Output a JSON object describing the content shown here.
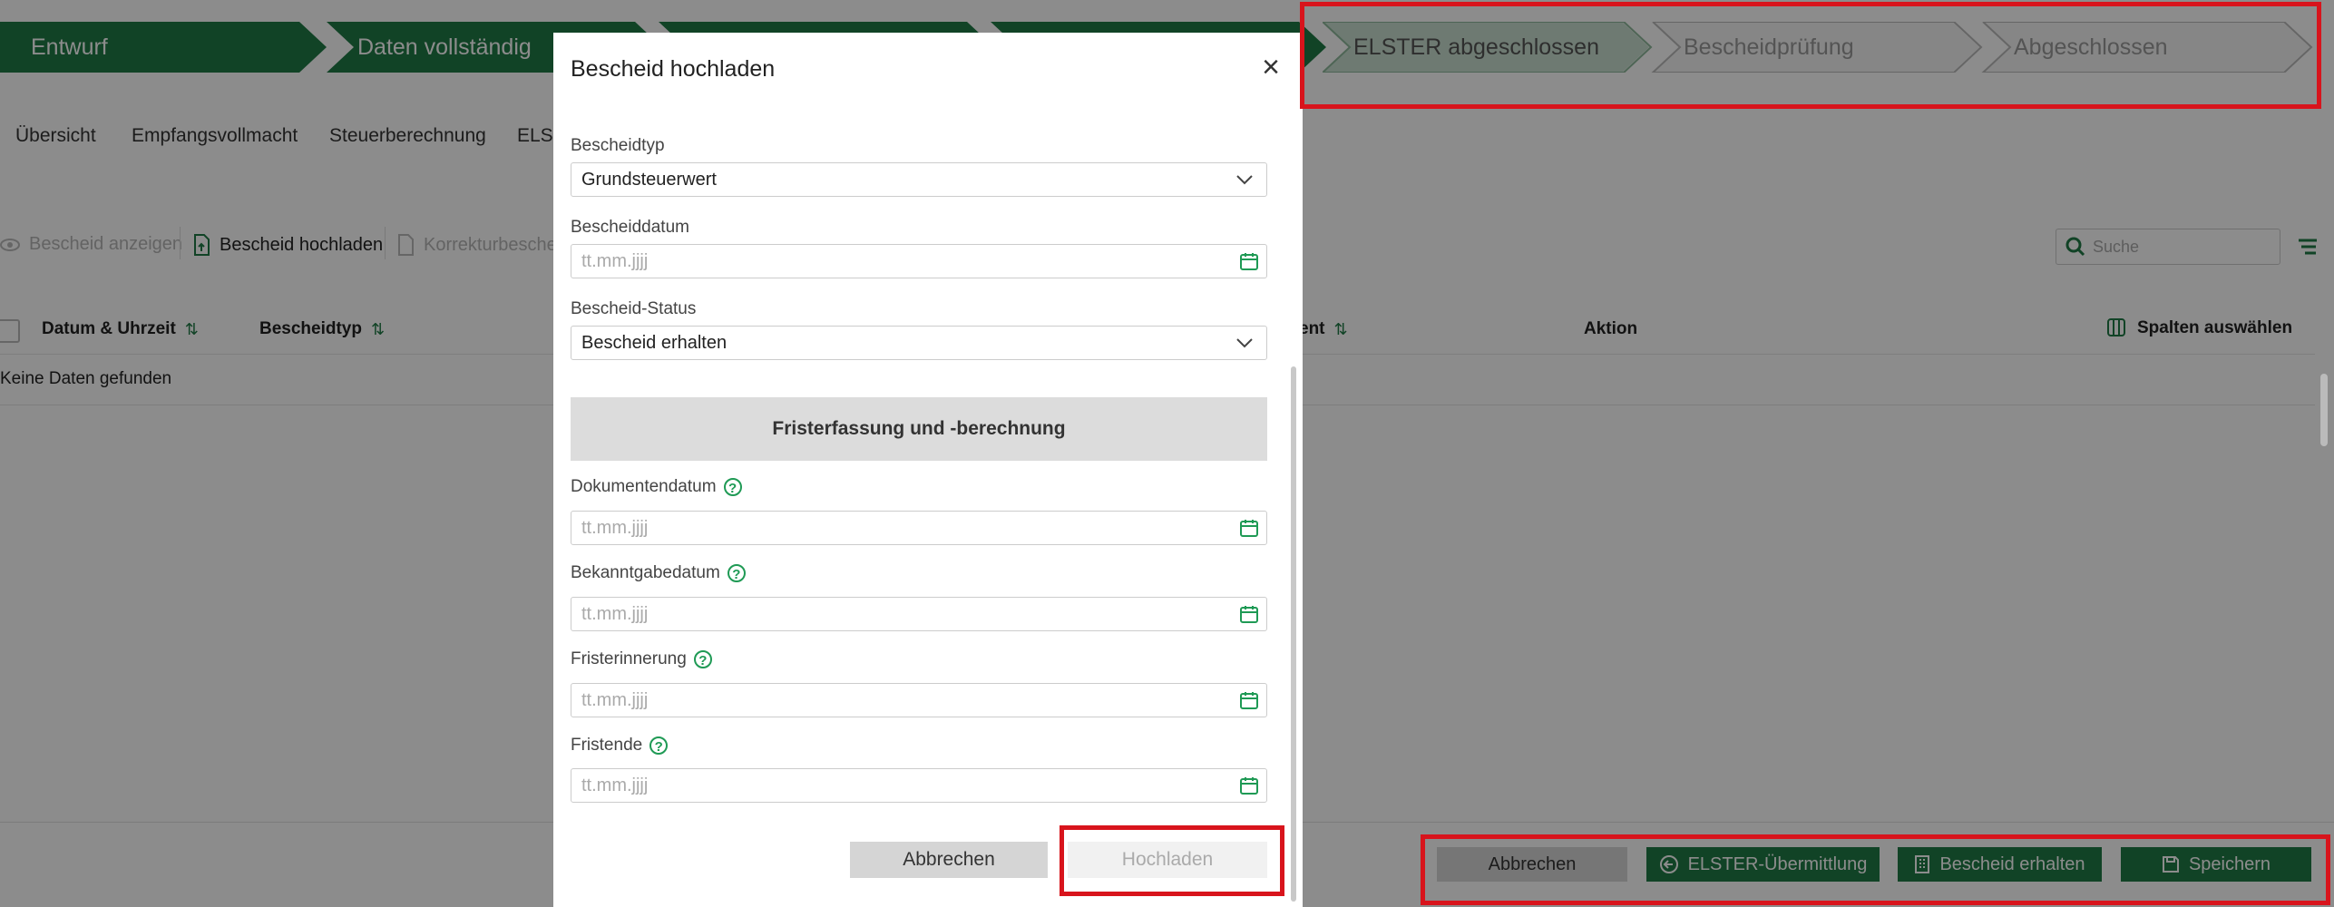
{
  "workflow": {
    "steps": [
      {
        "label": "Entwurf",
        "state": "done"
      },
      {
        "label": "Daten vollständig",
        "state": "done"
      },
      {
        "label": "",
        "state": "done"
      },
      {
        "label": "",
        "state": "done"
      },
      {
        "label": "ELSTER abgeschlossen",
        "state": "current"
      },
      {
        "label": "Bescheidprüfung",
        "state": "todo"
      },
      {
        "label": "Abgeschlossen",
        "state": "todo"
      }
    ]
  },
  "nav": {
    "tabs": [
      "Übersicht",
      "Empfangsvollmacht",
      "Steuerberechnung",
      "ELST"
    ]
  },
  "toolbar": {
    "show_label": "Bescheid anzeigen",
    "upload_label": "Bescheid hochladen",
    "correction_label": "Korrekturbeschei",
    "search_placeholder": "Suche"
  },
  "table": {
    "columns": [
      "Datum & Uhrzeit",
      "Bescheidtyp",
      "ent",
      "Aktion"
    ],
    "columns_button": "Spalten auswählen",
    "empty_text": "Keine Daten gefunden"
  },
  "footer": {
    "cancel": "Abbrechen",
    "elster": "ELSTER-Übermittlung",
    "received": "Bescheid erhalten",
    "save": "Speichern"
  },
  "modal": {
    "title": "Bescheid hochladen",
    "bescheidtyp_label": "Bescheidtyp",
    "bescheidtyp_value": "Grundsteuerwert",
    "bescheiddatum_label": "Bescheiddatum",
    "status_label": "Bescheid-Status",
    "status_value": "Bescheid erhalten",
    "section_title": "Fristerfassung und -berechnung",
    "dokumentendatum_label": "Dokumentendatum",
    "bekanntgabedatum_label": "Bekanntgabedatum",
    "fristerinnerung_label": "Fristerinnerung",
    "fristende_label": "Fristende",
    "date_placeholder": "tt.mm.jjjj",
    "cancel_button": "Abbrechen",
    "upload_button": "Hochladen"
  },
  "colors": {
    "accent": "#1f7a45",
    "highlight": "#d8141c"
  }
}
